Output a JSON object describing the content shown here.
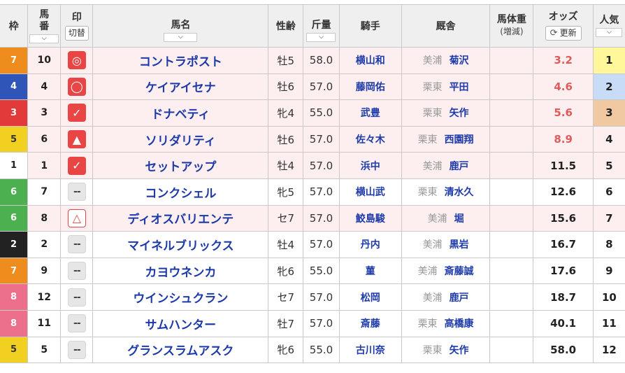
{
  "header": {
    "waku": "枠",
    "umaban_1": "馬",
    "umaban_2": "番",
    "mark": "印",
    "mark_toggle": "切替",
    "horse_name": "馬名",
    "sex_age": "性齢",
    "weight": "斤量",
    "jockey": "騎手",
    "stable": "厩舎",
    "body_weight": "馬体重",
    "body_weight_change": "(増減)",
    "odds": "オッズ",
    "refresh": "更新",
    "popularity": "人気",
    "sort_arrow": "⌵"
  },
  "waku_colors": {
    "1": "#ffffff",
    "2": "#222222",
    "3": "#e23a3a",
    "4": "#2f55b8",
    "5": "#f2d022",
    "6": "#4caf50",
    "7": "#ef8c1e",
    "8": "#ec6f8b"
  },
  "mark_styles": {
    "double-circle": {
      "glyph": "◎",
      "icon": "double-circle-icon",
      "style": "red"
    },
    "circle": {
      "glyph": "◯",
      "icon": "circle-icon",
      "style": "red"
    },
    "check": {
      "glyph": "✓",
      "icon": "check-icon",
      "style": "red"
    },
    "triangle": {
      "glyph": "▲",
      "icon": "triangle-icon",
      "style": "red"
    },
    "hollow-triangle": {
      "glyph": "△",
      "icon": "hollow-triangle-icon",
      "style": "outline"
    },
    "none": {
      "glyph": "--",
      "icon": "dash-icon",
      "style": "none"
    }
  },
  "odds_highlight_color": "#e05b5b",
  "popularity_colors": {
    "1": "#fff79a",
    "2": "#c8dbf7",
    "3": "#f0c9a2"
  },
  "horses": [
    {
      "waku": 7,
      "umaban": "10",
      "mark": "double-circle",
      "name": "コントラポスト",
      "sex_age": "牡5",
      "weight": "58.0",
      "jockey": "横山和",
      "region": "美浦",
      "trainer": "菊沢",
      "body_weight": "",
      "odds": "3.2",
      "popularity": "1",
      "highlight": true
    },
    {
      "waku": 4,
      "umaban": "4",
      "mark": "circle",
      "name": "ケイアイセナ",
      "sex_age": "牡6",
      "weight": "57.0",
      "jockey": "藤岡佑",
      "region": "栗東",
      "trainer": "平田",
      "body_weight": "",
      "odds": "4.6",
      "popularity": "2",
      "highlight": true
    },
    {
      "waku": 3,
      "umaban": "3",
      "mark": "check",
      "name": "ドナベティ",
      "sex_age": "牝4",
      "weight": "55.0",
      "jockey": "武豊",
      "region": "栗東",
      "trainer": "矢作",
      "body_weight": "",
      "odds": "5.6",
      "popularity": "3",
      "highlight": true
    },
    {
      "waku": 5,
      "umaban": "6",
      "mark": "triangle",
      "name": "ソリダリティ",
      "sex_age": "牡6",
      "weight": "57.0",
      "jockey": "佐々木",
      "region": "栗東",
      "trainer": "西園翔",
      "body_weight": "",
      "odds": "8.9",
      "popularity": "4",
      "highlight": true
    },
    {
      "waku": 1,
      "umaban": "1",
      "mark": "check",
      "name": "セットアップ",
      "sex_age": "牡4",
      "weight": "57.0",
      "jockey": "浜中",
      "region": "美浦",
      "trainer": "鹿戸",
      "body_weight": "",
      "odds": "11.5",
      "popularity": "5",
      "highlight": true
    },
    {
      "waku": 6,
      "umaban": "7",
      "mark": "none",
      "name": "コンクシェル",
      "sex_age": "牝5",
      "weight": "57.0",
      "jockey": "横山武",
      "region": "栗東",
      "trainer": "清水久",
      "body_weight": "",
      "odds": "12.6",
      "popularity": "6",
      "highlight": false
    },
    {
      "waku": 6,
      "umaban": "8",
      "mark": "hollow-triangle",
      "name": "ディオスバリエンテ",
      "sex_age": "セ7",
      "weight": "57.0",
      "jockey": "鮫島駿",
      "region": "美浦",
      "trainer": "堀",
      "body_weight": "",
      "odds": "15.6",
      "popularity": "7",
      "highlight": true
    },
    {
      "waku": 2,
      "umaban": "2",
      "mark": "none",
      "name": "マイネルブリックス",
      "sex_age": "牡4",
      "weight": "57.0",
      "jockey": "丹内",
      "region": "美浦",
      "trainer": "黒岩",
      "body_weight": "",
      "odds": "16.7",
      "popularity": "8",
      "highlight": false
    },
    {
      "waku": 7,
      "umaban": "9",
      "mark": "none",
      "name": "カヨウネンカ",
      "sex_age": "牝6",
      "weight": "55.0",
      "jockey": "菫",
      "region": "美浦",
      "trainer": "斎藤誠",
      "body_weight": "",
      "odds": "17.6",
      "popularity": "9",
      "highlight": false
    },
    {
      "waku": 8,
      "umaban": "12",
      "mark": "none",
      "name": "ウインシュクラン",
      "sex_age": "セ7",
      "weight": "57.0",
      "jockey": "松岡",
      "region": "美浦",
      "trainer": "鹿戸",
      "body_weight": "",
      "odds": "18.7",
      "popularity": "10",
      "highlight": false
    },
    {
      "waku": 8,
      "umaban": "11",
      "mark": "none",
      "name": "サムハンター",
      "sex_age": "牡7",
      "weight": "57.0",
      "jockey": "斎藤",
      "region": "栗東",
      "trainer": "高橋康",
      "body_weight": "",
      "odds": "40.1",
      "popularity": "11",
      "highlight": false
    },
    {
      "waku": 5,
      "umaban": "5",
      "mark": "none",
      "name": "グランスラムアスク",
      "sex_age": "牝6",
      "weight": "55.0",
      "jockey": "古川奈",
      "region": "栗東",
      "trainer": "矢作",
      "body_weight": "",
      "odds": "58.0",
      "popularity": "12",
      "highlight": false
    }
  ]
}
